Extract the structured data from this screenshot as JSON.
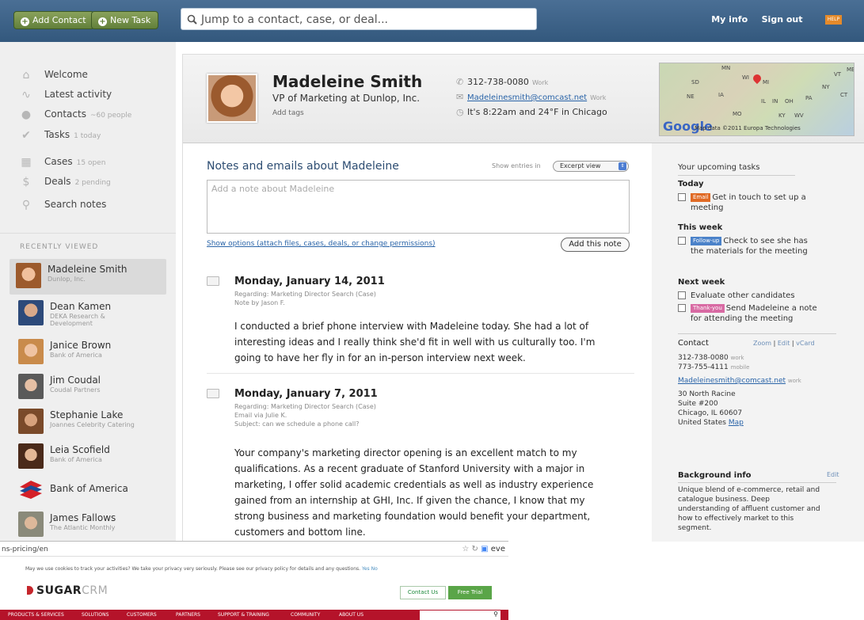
{
  "topbar": {
    "add_contact": "Add Contact",
    "new_task": "New Task",
    "search_placeholder": "Jump to a contact, case, or deal...",
    "my_info": "My info",
    "sign_out": "Sign out",
    "help": "HELP"
  },
  "nav": [
    {
      "label": "Welcome",
      "count": ""
    },
    {
      "label": "Latest activity",
      "count": ""
    },
    {
      "label": "Contacts",
      "count": "~60 people"
    },
    {
      "label": "Tasks",
      "count": "1 today"
    },
    {
      "label": "Cases",
      "count": "15 open"
    },
    {
      "label": "Deals",
      "count": "2 pending"
    },
    {
      "label": "Search notes",
      "count": ""
    }
  ],
  "recently_viewed": {
    "heading": "RECENTLY VIEWED",
    "items": [
      {
        "name": "Madeleine Smith",
        "sub": "Dunlop, Inc."
      },
      {
        "name": "Dean Kamen",
        "sub": "DEKA Research & Development"
      },
      {
        "name": "Janice Brown",
        "sub": "Bank of America"
      },
      {
        "name": "Jim Coudal",
        "sub": "Coudal Partners"
      },
      {
        "name": "Stephanie Lake",
        "sub": "Joannes Celebrity Catering"
      },
      {
        "name": "Leia Scofield",
        "sub": "Bank of America"
      },
      {
        "name": "Bank of America",
        "sub": ""
      },
      {
        "name": "James Fallows",
        "sub": "The Atlantic Monthly"
      }
    ]
  },
  "person": {
    "name": "Madeleine Smith",
    "title": "VP of Marketing at Dunlop, Inc.",
    "add_tags": "Add tags",
    "phone": "312-738-0080",
    "phone_type": "Work",
    "email": "Madeleinesmith@comcast.net",
    "email_type": "Work",
    "time": "It's 8:22am and 24°F in Chicago"
  },
  "map": {
    "google": "Google",
    "copyright": "Map data ©2011 Europa Technologies",
    "states": [
      "MN",
      "WI",
      "MI",
      "SD",
      "NE",
      "IA",
      "IL",
      "IN",
      "OH",
      "PA",
      "NY",
      "MO",
      "KY",
      "WV",
      "VT",
      "ME",
      "CT"
    ]
  },
  "notes": {
    "title": "Notes and emails about Madeleine",
    "show_entries": "Show entries in",
    "view": "Excerpt view",
    "placeholder": "Add a note about Madeleine",
    "show_options": "Show options (attach files, cases, deals, or change permissions)",
    "add_button": "Add this note",
    "entries": [
      {
        "date": "Monday, January 14, 2011",
        "regarding": "Regarding: Marketing Director Search (Case)",
        "by": "Note by Jason F.",
        "subject": "",
        "body": "I conducted a brief phone interview with Madeleine today. She had a lot of interesting ideas and I really think she'd fit in well with us culturally too. I'm going to have her fly in for an in-person interview next week."
      },
      {
        "date": "Monday, January 7, 2011",
        "regarding": "Regarding: Marketing Director Search (Case)",
        "by": "Email via Julie K.",
        "subject": "Subject: can we schedule a phone call?",
        "body": "Your company's marketing director opening is an excellent match to my qualifications. As a recent graduate of Stanford University with a major in marketing, I offer solid academic credentials as well as industry experience gained from an internship at GHI, Inc. If given the chance, I know that my strong business and marketing foundation would benefit your department, customers and bottom line."
      }
    ]
  },
  "tasks": {
    "title": "Your upcoming tasks",
    "today": "Today",
    "today_badge": "Email",
    "today_task": "Get in touch to set up a meeting",
    "this_week": "This week",
    "week_badge": "Follow-up",
    "week_task": "Check to see she has the materials for the meeting",
    "next_week": "Next week",
    "next_task1": "Evaluate other candidates",
    "next_badge": "Thank-you",
    "next_task2": "Send Madeleine a note for attending the meeting"
  },
  "contact": {
    "title": "Contact",
    "zoom": "Zoom",
    "edit": "Edit",
    "vcard": "vCard",
    "phone1": "312-738-0080",
    "phone1_type": "work",
    "phone2": "773-755-4111",
    "phone2_type": "mobile",
    "email": "Madeleinesmith@comcast.net",
    "email_type": "work",
    "addr1": "30 North Racine",
    "addr2": "Suite #200",
    "addr3": "Chicago, IL 60607",
    "addr4": "United States",
    "map": "Map"
  },
  "background": {
    "title": "Background info",
    "edit": "Edit",
    "text": "Unique blend of e-commerce, retail and catalogue business. Deep understanding of affluent customer and how to effectively market to this segment."
  },
  "browser": {
    "url": "ns-pricing/en",
    "search_hint": "eve",
    "cookie": "May we use cookies to track your activities? We take your privacy very seriously. Please see our privacy policy for details and any questions.",
    "cookie_yes": "Yes",
    "cookie_no": "No",
    "logo_sugar": "SUGAR",
    "logo_crm": "CRM",
    "contact_us": "Contact Us",
    "free_trial": "Free Trial",
    "nav": [
      "PRODUCTS & SERVICES",
      "SOLUTIONS",
      "CUSTOMERS",
      "PARTNERS",
      "SUPPORT & TRAINING",
      "COMMUNITY",
      "ABOUT US"
    ],
    "search": "Search"
  },
  "colors": {
    "topbar": "#3d6289",
    "accent_link": "#2a64a8",
    "email_badge": "#e06a25",
    "followup_badge": "#4b82c9",
    "thankyou_badge": "#d86aa3",
    "sugar_red": "#b5132a"
  }
}
